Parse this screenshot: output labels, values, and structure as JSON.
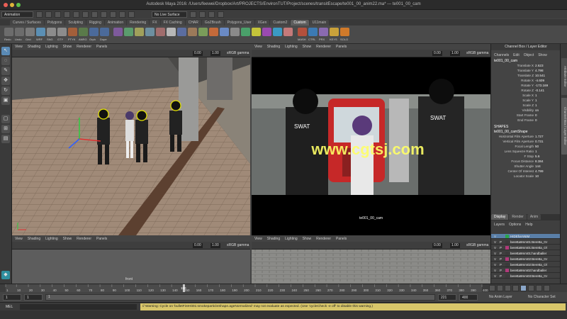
{
  "window": {
    "title": "Autodesk Maya 2016: /Users/feewei/Dropbox/Art/PROJECTS/EnvironTUT/Project/scenes/transitEscape/te001_00_anim22.ma*  ---  te001_00_cam"
  },
  "status_line": {
    "menu_set": "Animation",
    "live_surface": "No Live Surface"
  },
  "shelf_tabs": [
    "Curves / Surfaces",
    "Polygons",
    "Sculpting",
    "Rigging",
    "Animation",
    "Rendering",
    "FX",
    "FX Caching",
    "CHAR",
    "GoZBrush",
    "Polygons_User",
    "XGen",
    "Custom2",
    "Custom",
    "U11main"
  ],
  "active_shelf": "Custom",
  "shelf_icon_labels": [
    "Redo",
    "Undo",
    "Grid",
    "WRF",
    "SNG",
    "GTY",
    "PTYK",
    "ANRG",
    "Grph",
    "Dope",
    "MASH",
    "CTRL",
    "PRX",
    "KEYS",
    "SOLO"
  ],
  "viewport_menu": [
    "View",
    "Shading",
    "Lighting",
    "Show",
    "Renderer",
    "Panels"
  ],
  "viewports": {
    "top_left": {
      "exposure": "0.00",
      "gamma": "1.00",
      "color": "sRGB gamma",
      "camera": ""
    },
    "top_right": {
      "exposure": "0.00",
      "gamma": "1.00",
      "color": "sRGB gamma",
      "camera": "te001_00_cam"
    },
    "bottom_left": {
      "exposure": "0.00",
      "gamma": "1.00",
      "color": "sRGB gamma",
      "camera": "front"
    },
    "bottom_right": {
      "exposure": "0.00",
      "gamma": "1.00",
      "color": "sRGB gamma",
      "camera": ""
    }
  },
  "watermark": "www.cgtsj.com",
  "channel_box": {
    "header": "Channel Box / Layer Editor",
    "menus": [
      "Channels",
      "Edit",
      "Object",
      "Show"
    ],
    "object_name": "te001_00_cam",
    "transform": [
      {
        "label": "Translate X",
        "value": "2.623"
      },
      {
        "label": "Translate Y",
        "value": "4.798"
      },
      {
        "label": "Translate Z",
        "value": "10.541"
      },
      {
        "label": "Rotate X",
        "value": "-4.609"
      },
      {
        "label": "Rotate Y",
        "value": "-173.169"
      },
      {
        "label": "Rotate Z",
        "value": "-0.141"
      },
      {
        "label": "Scale X",
        "value": "1"
      },
      {
        "label": "Scale Y",
        "value": "1"
      },
      {
        "label": "Scale Z",
        "value": "1"
      },
      {
        "label": "Visibility",
        "value": "on"
      },
      {
        "label": "Start Frame",
        "value": "0"
      },
      {
        "label": "End Frame",
        "value": "0"
      }
    ],
    "shapes_header": "SHAPES",
    "shape_name": "te001_00_camShape",
    "shape_attrs": [
      {
        "label": "Horizontal Film Aperture",
        "value": "1.727"
      },
      {
        "label": "Vertical Film Aperture",
        "value": "0.731"
      },
      {
        "label": "Focal Length",
        "value": "50"
      },
      {
        "label": "Lens Squeeze Ratio",
        "value": "1"
      },
      {
        "label": "F Stop",
        "value": "5.6"
      },
      {
        "label": "Focus Distance",
        "value": "8.384"
      },
      {
        "label": "Shutter Angle",
        "value": "144"
      },
      {
        "label": "Center Of Interest",
        "value": "4.799"
      },
      {
        "label": "Locator Scale",
        "value": "10"
      }
    ]
  },
  "layer_editor": {
    "tabs": [
      "Display",
      "Render",
      "Anim"
    ],
    "active_tab": "Display",
    "menus": [
      "Layers",
      "Options",
      "Help"
    ],
    "layers": [
      {
        "v": "V",
        "p": "",
        "color": "#2aa64a",
        "name": "HIDEforANIM",
        "selected": true
      },
      {
        "v": "V",
        "p": "P",
        "color": "#3a3a3a",
        "name": "beretta9mm01:Beretta_Gr"
      },
      {
        "v": "V",
        "p": "P",
        "color": "#b0397a",
        "name": "beretta9mm01:Beretta_Ol"
      },
      {
        "v": "V",
        "p": "P",
        "color": "#3a3a3a",
        "name": "beretta9mm01:handballer"
      },
      {
        "v": "V",
        "p": "P",
        "color": "#b0397a",
        "name": "beretta9mm02:Beretta_Gr"
      },
      {
        "v": "V",
        "p": "P",
        "color": "#3a3a3a",
        "name": "beretta9mm02:Beretta_Ol"
      },
      {
        "v": "V",
        "p": "P",
        "color": "#b0397a",
        "name": "beretta9mm02:handballer"
      },
      {
        "v": "V",
        "p": "P",
        "color": "#3a3a3a",
        "name": "beretta9mm03:Beretta_Gr"
      }
    ]
  },
  "right_strip_tabs": [
    "Attribute Editor",
    "Channel Box / Layer Editor"
  ],
  "time_slider": {
    "ticks": [
      "1",
      "10",
      "20",
      "30",
      "40",
      "50",
      "60",
      "70",
      "80",
      "90",
      "100",
      "110",
      "120",
      "130",
      "140",
      "150",
      "160",
      "170",
      "180",
      "190",
      "200",
      "210",
      "220",
      "230",
      "240",
      "250",
      "260",
      "270",
      "280",
      "290",
      "300",
      "310",
      "320",
      "330",
      "340",
      "350",
      "360",
      "370",
      "380",
      "390",
      "400"
    ],
    "current_frame": "150"
  },
  "range": {
    "start": "1",
    "playback_start": "1",
    "handle": "1",
    "playback_end": "221",
    "end": "400",
    "anim_layer": "No Anim Layer",
    "char_set": "No Character Set"
  },
  "command_line": {
    "label": "MEL",
    "message": "// Warning: Cycle on 'bulletFireHit01:smokeparticleShape.ageNormalized' may not evaluate as expected.  (Use 'cycleCheck -e off' to disable this warning.)"
  }
}
